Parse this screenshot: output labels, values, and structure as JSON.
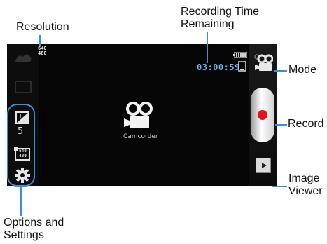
{
  "callouts": {
    "resolution": "Resolution",
    "recording_time": [
      "Recording Time",
      "Remaining"
    ],
    "mode": "Mode",
    "record": "Record",
    "image_viewer": [
      "Image",
      "Viewer"
    ],
    "options": [
      "Options and",
      "Settings"
    ]
  },
  "screen": {
    "resolution_badge": [
      "640",
      "480"
    ],
    "time_remaining": "03:00:59",
    "center_label": "Camcorder",
    "exposure_value": "5",
    "res_icon_text": [
      "640",
      "480"
    ]
  },
  "colors": {
    "callout_line": "#3a8fd6",
    "record": "#e8121e",
    "time": "#6fb7e8"
  }
}
